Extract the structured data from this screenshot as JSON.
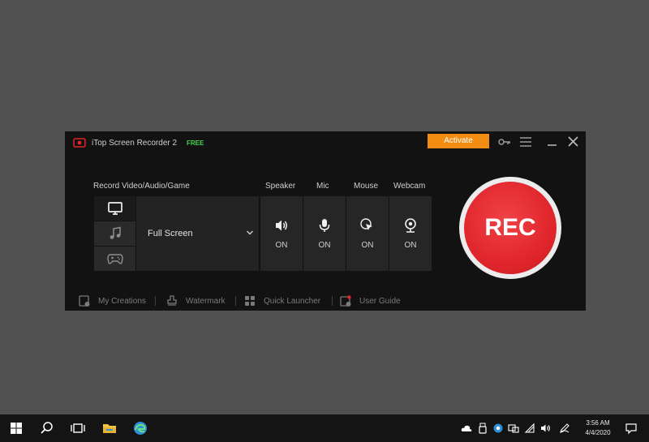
{
  "app": {
    "title": "iTop Screen Recorder 2",
    "badge": "FREE",
    "activate_label": "Activate",
    "accent_color": "#f28c13",
    "rec_color": "#e0262c"
  },
  "labels": {
    "record": "Record Video/Audio/Game",
    "speaker": "Speaker",
    "mic": "Mic",
    "mouse": "Mouse",
    "webcam": "Webcam"
  },
  "modes": [
    "monitor-icon",
    "music-note-icon",
    "gamepad-icon"
  ],
  "screen_select": {
    "value": "Full Screen"
  },
  "toggles": {
    "speaker": {
      "state": "ON",
      "icon": "speaker-icon"
    },
    "mic": {
      "state": "ON",
      "icon": "microphone-icon"
    },
    "mouse": {
      "state": "ON",
      "icon": "mouse-cursor-icon"
    },
    "webcam": {
      "state": "ON",
      "icon": "webcam-icon"
    }
  },
  "rec_label": "REC",
  "bottom_links": {
    "creations": "My Creations",
    "watermark": "Watermark",
    "launcher": "Quick Launcher",
    "guide": "User Guide"
  },
  "taskbar": {
    "time": "3:56 AM",
    "date": "4/4/2020"
  }
}
